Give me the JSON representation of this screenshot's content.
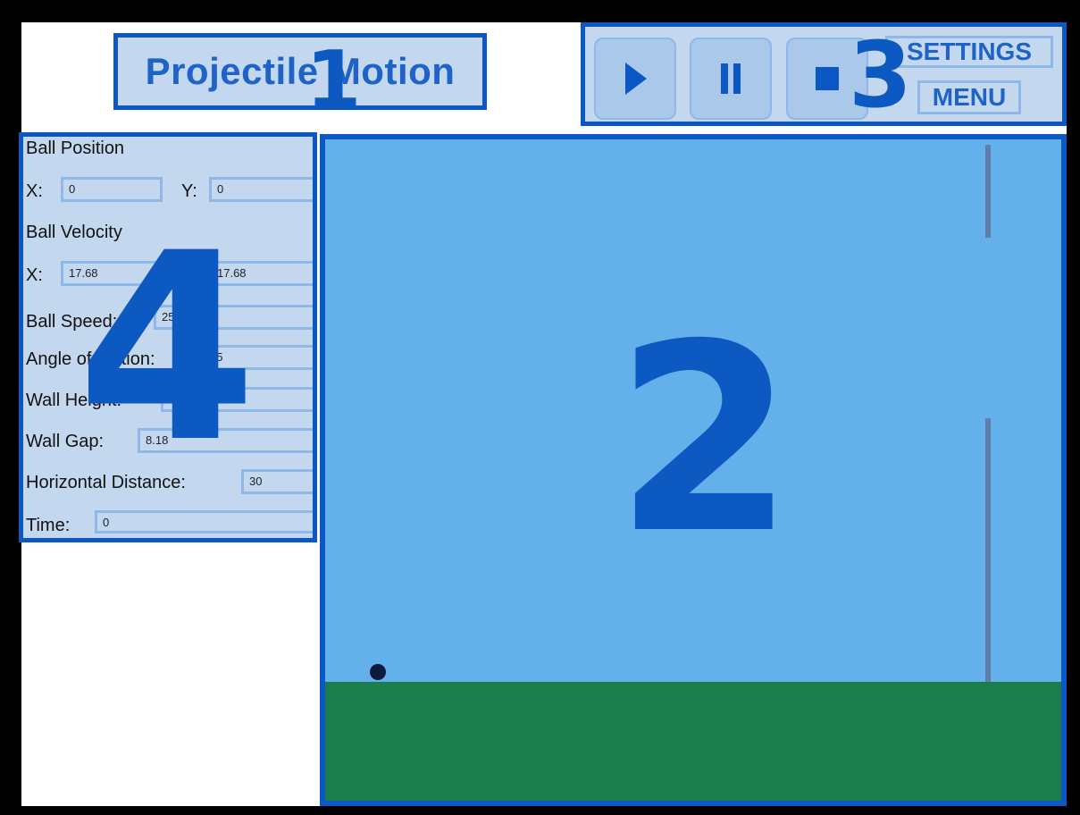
{
  "app": {
    "title": "Projectile Motion"
  },
  "toolbar": {
    "play_icon": "play-icon",
    "pause_icon": "pause-icon",
    "stop_icon": "stop-icon",
    "settings_label": "SETTINGS",
    "menu_label": "MENU"
  },
  "panel": {
    "ball_position_heading": "Ball Position",
    "position_x_label": "X:",
    "position_x_value": "0",
    "position_y_label": "Y:",
    "position_y_value": "0",
    "ball_velocity_heading": "Ball Velocity",
    "velocity_x_label": "X:",
    "velocity_x_value": "17.68",
    "velocity_y_value": "17.68",
    "ball_speed_label": "Ball Speed:",
    "ball_speed_value": "25",
    "angle_label": "Angle of Motion:",
    "angle_value": "45",
    "wall_height_label": "Wall Height:",
    "wall_height_value": "10",
    "wall_gap_label": "Wall Gap:",
    "wall_gap_value": "8.18",
    "horizontal_distance_label": "Horizontal Distance:",
    "horizontal_distance_value": "30",
    "time_label": "Time:",
    "time_value": "0"
  },
  "markers": {
    "title_marker": "1",
    "simulation_marker": "2",
    "toolbar_marker": "3",
    "panel_marker": "4"
  },
  "colors": {
    "accent_border": "#0b58c5",
    "panel_background": "#c3d8ef",
    "sky": "#64b0ea",
    "ground": "#1c7d4c",
    "wall": "#5f7fa8",
    "ball": "#0d1b3c",
    "title_text": "#1f63c9"
  }
}
